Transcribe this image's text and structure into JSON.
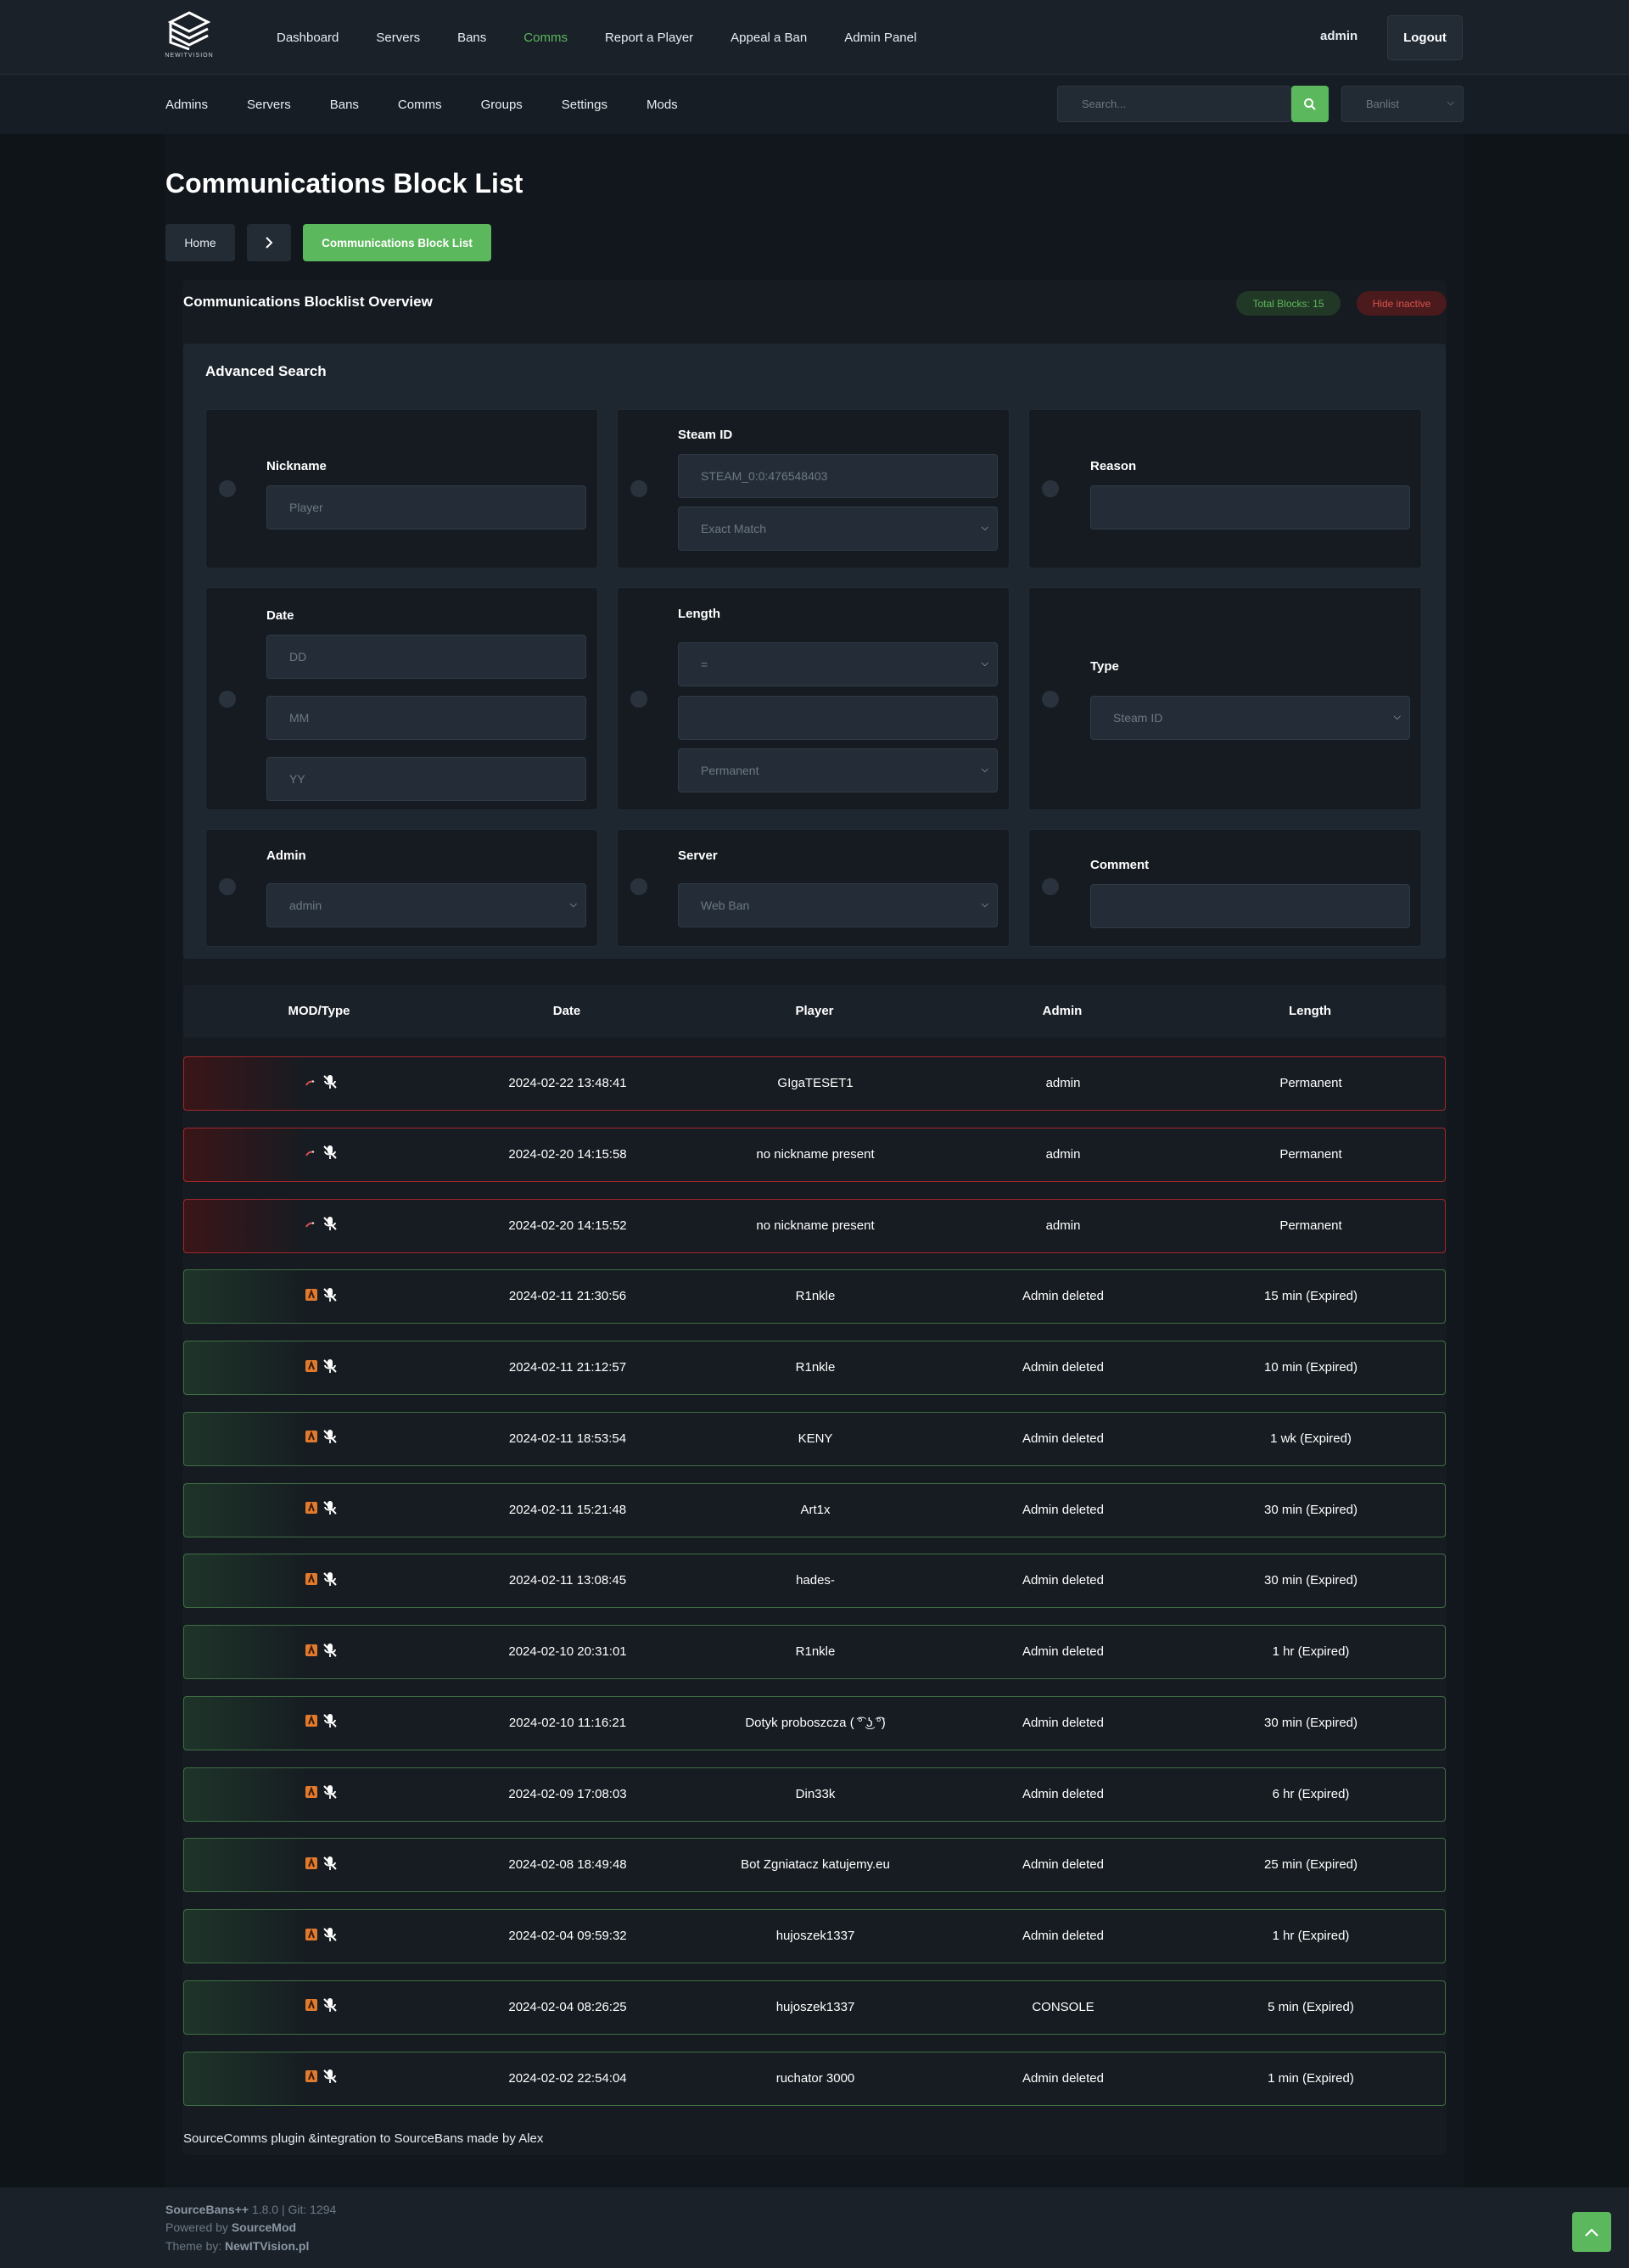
{
  "header": {
    "logo_text": "NEWITVISION",
    "nav": [
      "Dashboard",
      "Servers",
      "Bans",
      "Comms",
      "Report a Player",
      "Appeal a Ban",
      "Admin Panel"
    ],
    "user": "admin",
    "logout": "Logout"
  },
  "subnav": {
    "items": [
      "Admins",
      "Servers",
      "Bans",
      "Comms",
      "Groups",
      "Settings",
      "Mods"
    ],
    "search_placeholder": "Search...",
    "banlist_value": "Banlist"
  },
  "page": {
    "title": "Communications Block List",
    "breadcrumb": [
      "Home",
      "Communications Block List"
    ]
  },
  "overview": {
    "title": "Communications Blocklist Overview",
    "total_badge": "Total Blocks: 15",
    "hide_inactive": "Hide inactive"
  },
  "search": {
    "title": "Advanced Search",
    "nickname_label": "Nickname",
    "nickname_placeholder": "Player",
    "steamid_label": "Steam ID",
    "steamid_placeholder": "STEAM_0:0:476548403",
    "steamid_match": "Exact Match",
    "reason_label": "Reason",
    "date_label": "Date",
    "date_dd": "DD",
    "date_mm": "MM",
    "date_yy": "YY",
    "length_label": "Length",
    "length_op": "=",
    "length_unit": "Permanent",
    "type_label": "Type",
    "type_value": "Steam ID",
    "admin_label": "Admin",
    "admin_value": "admin",
    "server_label": "Server",
    "server_value": "Web Ban",
    "comment_label": "Comment"
  },
  "table": {
    "headers": [
      "MOD/Type",
      "Date",
      "Player",
      "Admin",
      "Length"
    ],
    "rows": [
      {
        "status": "active",
        "date": "2024-02-22 13:48:41",
        "player": "GIgaTESET1",
        "admin": "admin",
        "length": "Permanent"
      },
      {
        "status": "active",
        "date": "2024-02-20 14:15:58",
        "player": "no nickname present",
        "admin": "admin",
        "length": "Permanent"
      },
      {
        "status": "active",
        "date": "2024-02-20 14:15:52",
        "player": "no nickname present",
        "admin": "admin",
        "length": "Permanent"
      },
      {
        "status": "expired",
        "date": "2024-02-11 21:30:56",
        "player": "R1nkle",
        "admin": "Admin deleted",
        "length": "15 min (Expired)"
      },
      {
        "status": "expired",
        "date": "2024-02-11 21:12:57",
        "player": "R1nkle",
        "admin": "Admin deleted",
        "length": "10 min (Expired)"
      },
      {
        "status": "expired",
        "date": "2024-02-11 18:53:54",
        "player": "KENY",
        "admin": "Admin deleted",
        "length": "1 wk (Expired)"
      },
      {
        "status": "expired",
        "date": "2024-02-11 15:21:48",
        "player": "Art1x",
        "admin": "Admin deleted",
        "length": "30 min (Expired)"
      },
      {
        "status": "expired",
        "date": "2024-02-11 13:08:45",
        "player": "hades-",
        "admin": "Admin deleted",
        "length": "30 min (Expired)"
      },
      {
        "status": "expired",
        "date": "2024-02-10 20:31:01",
        "player": "R1nkle",
        "admin": "Admin deleted",
        "length": "1 hr (Expired)"
      },
      {
        "status": "expired",
        "date": "2024-02-10 11:16:21",
        "player": "Dotyk proboszcza ( ͡° ͜ʖ ͡°)",
        "admin": "Admin deleted",
        "length": "30 min (Expired)"
      },
      {
        "status": "expired",
        "date": "2024-02-09 17:08:03",
        "player": "Din33k",
        "admin": "Admin deleted",
        "length": "6 hr (Expired)"
      },
      {
        "status": "expired",
        "date": "2024-02-08 18:49:48",
        "player": "Bot Zgniatacz katujemy.eu",
        "admin": "Admin deleted",
        "length": "25 min (Expired)"
      },
      {
        "status": "expired",
        "date": "2024-02-04 09:59:32",
        "player": "hujoszek1337",
        "admin": "Admin deleted",
        "length": "1 hr (Expired)"
      },
      {
        "status": "expired",
        "date": "2024-02-04 08:26:25",
        "player": "hujoszek1337",
        "admin": "CONSOLE",
        "length": "5 min (Expired)"
      },
      {
        "status": "expired",
        "date": "2024-02-02 22:54:04",
        "player": "ruchator 3000",
        "admin": "Admin deleted",
        "length": "1 min (Expired)"
      }
    ]
  },
  "credit": "SourceComms plugin &integration to SourceBans made by Alex",
  "footer": {
    "line1_name": "SourceBans++",
    "line1_rest": " 1.8.0 | Git: 1294",
    "line2_pre": "Powered by ",
    "line2_name": "SourceMod",
    "line3_pre": "Theme by: ",
    "line3_name": "NewITVision.pl"
  },
  "colors": {
    "accent": "#5cb85c",
    "danger": "#d9534f"
  }
}
